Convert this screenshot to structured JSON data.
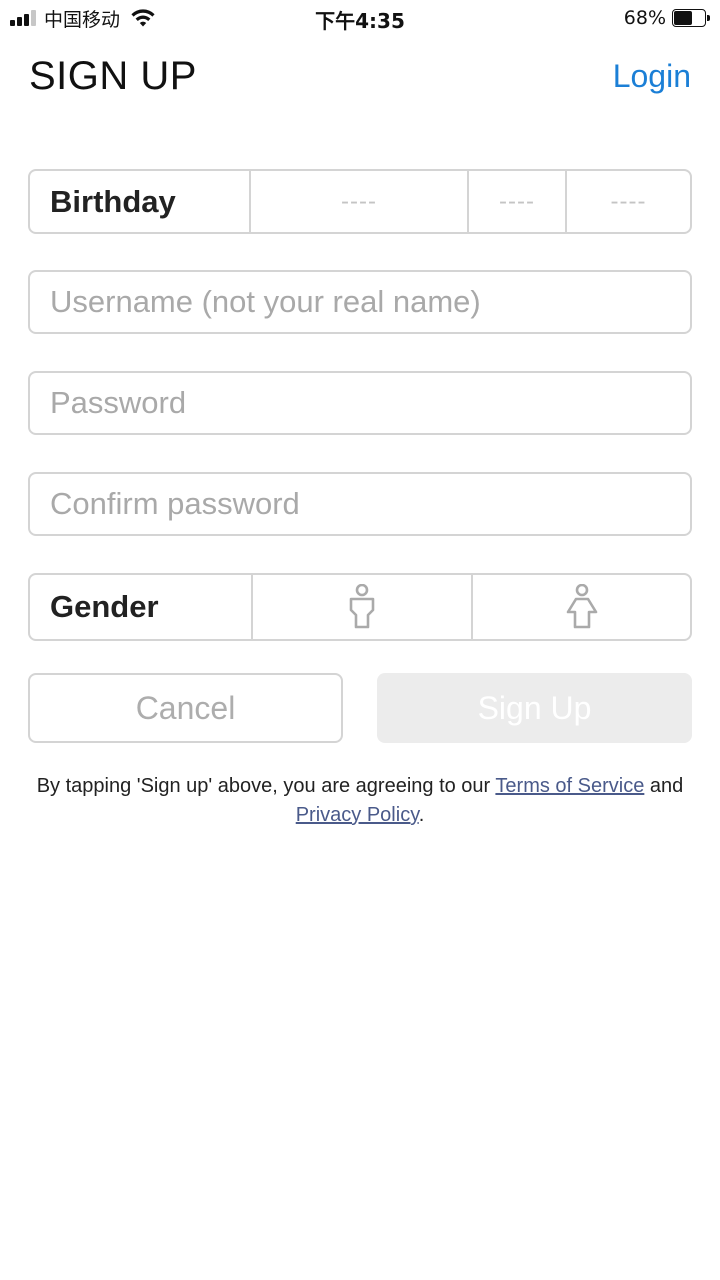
{
  "status_bar": {
    "carrier": "中国移动",
    "time": "下午4:35",
    "battery_percent": "68%",
    "battery_level": 0.68,
    "signal_bars_active": 3,
    "signal_bars_total": 4
  },
  "header": {
    "title": "SIGN UP",
    "login_label": "Login"
  },
  "birthday": {
    "label": "Birthday",
    "year_placeholder": "----",
    "month_placeholder": "----",
    "day_placeholder": "----"
  },
  "fields": {
    "username_placeholder": "Username (not your real name)",
    "username_value": "",
    "password_placeholder": "Password",
    "password_value": "",
    "confirm_password_placeholder": "Confirm password",
    "confirm_password_value": ""
  },
  "gender": {
    "label": "Gender",
    "options": [
      {
        "icon": "male-icon"
      },
      {
        "icon": "female-icon"
      }
    ]
  },
  "buttons": {
    "cancel_label": "Cancel",
    "signup_label": "Sign Up"
  },
  "legal": {
    "prefix": "By tapping 'Sign up' above, you are agreeing to our ",
    "terms_label": "Terms of Service",
    "middle": " and ",
    "privacy_label": "Privacy Policy",
    "suffix": "."
  },
  "colors": {
    "accent": "#1b7fd6",
    "link": "#4a5a8a",
    "border": "#d4d4d4",
    "placeholder": "#a9a9a9",
    "disabled_button_bg": "#ececec"
  }
}
